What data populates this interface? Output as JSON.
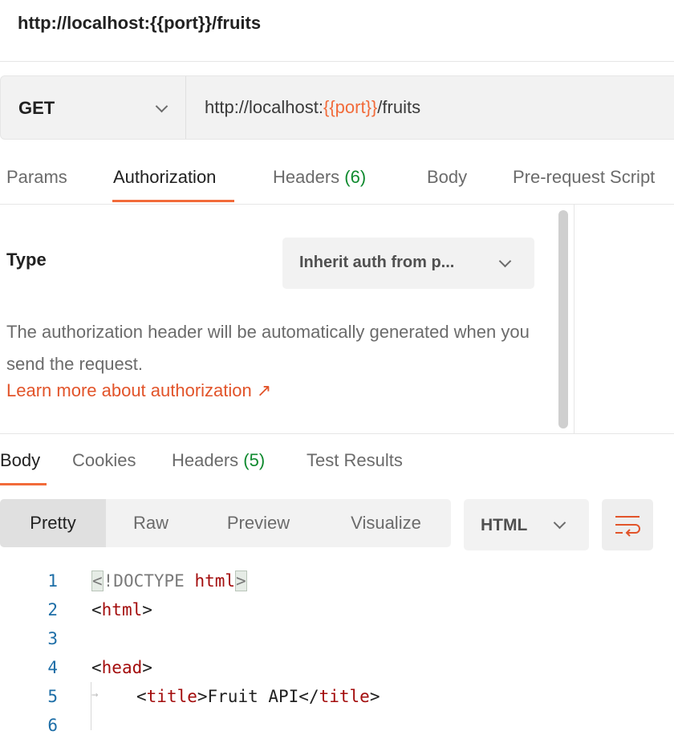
{
  "window": {
    "title": "http://localhost:{{port}}/fruits"
  },
  "request": {
    "method": "GET",
    "url_prefix": "http://localhost:",
    "url_variable": "{{port}}",
    "url_suffix": "/fruits"
  },
  "request_tabs": [
    {
      "label": "Params"
    },
    {
      "label": "Authorization",
      "active": true
    },
    {
      "label": "Headers",
      "count": "(6)"
    },
    {
      "label": "Body"
    },
    {
      "label": "Pre-request Script"
    }
  ],
  "auth": {
    "type_label": "Type",
    "type_value": "Inherit auth from p...",
    "description": "The authorization header will be automatically generated when you send the request.",
    "learn_more": "Learn more about authorization ↗"
  },
  "response_tabs": [
    {
      "label": "Body",
      "active": true
    },
    {
      "label": "Cookies"
    },
    {
      "label": "Headers",
      "count": "(5)"
    },
    {
      "label": "Test Results"
    }
  ],
  "view_modes": [
    {
      "label": "Pretty",
      "active": true
    },
    {
      "label": "Raw"
    },
    {
      "label": "Preview"
    },
    {
      "label": "Visualize"
    }
  ],
  "format": {
    "value": "HTML"
  },
  "code": {
    "line_numbers": [
      "1",
      "2",
      "3",
      "4",
      "5",
      "6"
    ],
    "l1_open": "<",
    "l1_doctype": "!DOCTYPE",
    "l1_html": "html",
    "l1_close": ">",
    "l2_open": "<",
    "l2_tag": "html",
    "l2_close": ">",
    "l4_open": "<",
    "l4_tag": "head",
    "l4_close": ">",
    "l5_open": "<",
    "l5_tag": "title",
    "l5_mid": ">Fruit API</",
    "l5_tag2": "title",
    "l5_close": ">"
  },
  "colors": {
    "accent": "#f26b3a",
    "link": "#e2542a",
    "count_green": "#0f8a2f",
    "tag_red": "#a30c0c",
    "line_number_blue": "#1d6ea7"
  }
}
